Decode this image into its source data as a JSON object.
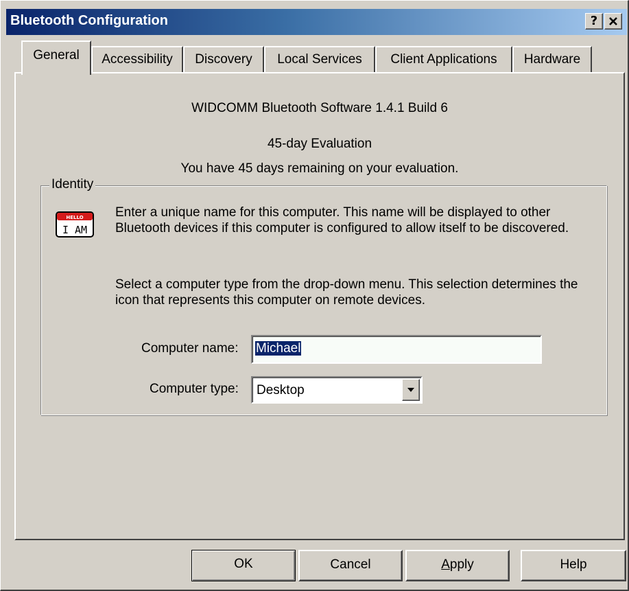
{
  "window": {
    "title": "Bluetooth Configuration",
    "help_button": "?",
    "close_button": "✕"
  },
  "tabs": [
    {
      "label": "General",
      "active": true
    },
    {
      "label": "Accessibility",
      "active": false
    },
    {
      "label": "Discovery",
      "active": false
    },
    {
      "label": "Local Services",
      "active": false
    },
    {
      "label": "Client Applications",
      "active": false
    },
    {
      "label": "Hardware",
      "active": false
    }
  ],
  "general": {
    "product_line": "WIDCOMM Bluetooth Software 1.4.1 Build 6",
    "evaluation_title": "45-day Evaluation",
    "evaluation_remaining": "You have 45 days remaining on your evaluation."
  },
  "identity": {
    "legend": "Identity",
    "icon": "hello-i-am-name-tag-icon",
    "icon_text_top": "HELLO",
    "icon_text_main": "I AM",
    "description_1": "Enter a unique name for this computer.  This name will be displayed to other Bluetooth devices if this computer is configured to allow itself to be discovered.",
    "description_2": "Select a computer type from the drop-down menu.  This selection determines the icon that represents this computer on remote devices.",
    "computer_name_label": "Computer name:",
    "computer_name_value": "Michael",
    "computer_type_label": "Computer type:",
    "computer_type_value": "Desktop"
  },
  "buttons": {
    "ok": "OK",
    "cancel": "Cancel",
    "apply_accel": "A",
    "apply_rest": "pply",
    "help": "Help"
  },
  "colors": {
    "title_gradient_start": "#0a246a",
    "title_gradient_end": "#a6caf0",
    "face": "#d4d0c8",
    "selection": "#0a246a"
  }
}
